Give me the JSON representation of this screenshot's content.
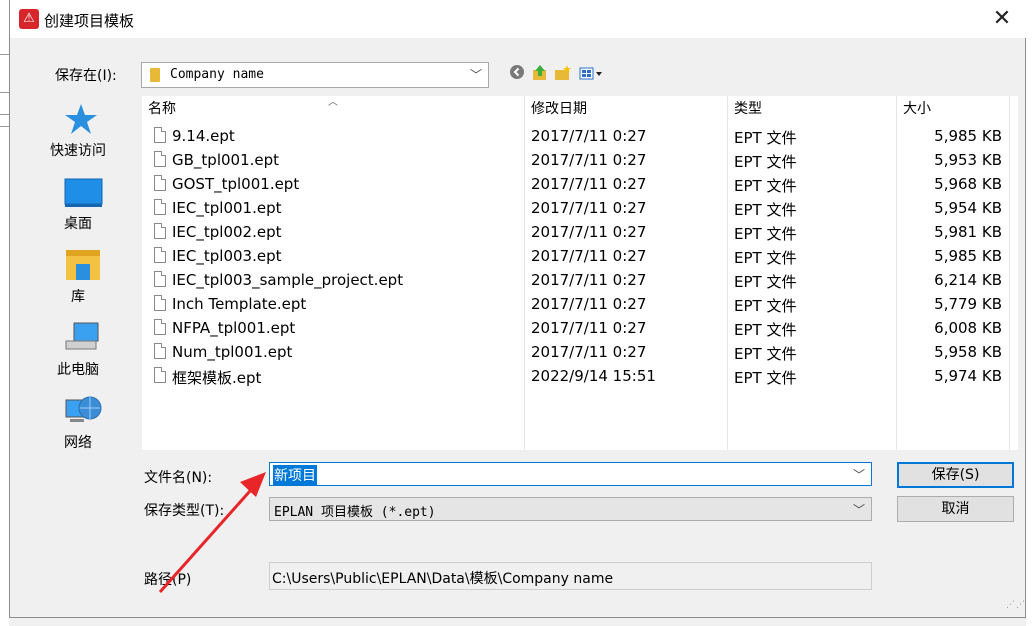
{
  "dialog": {
    "title": "创建项目模板",
    "close_glyph": "✕",
    "app_icon_glyph": "⚠"
  },
  "location": {
    "label": "保存在(I):",
    "value": "Company name"
  },
  "toolbar": {
    "back_icon": "back-icon",
    "up_icon": "up-folder-icon",
    "new_folder_icon": "new-folder-icon",
    "view_icon": "view-menu-icon"
  },
  "places": [
    {
      "label": "快速访问",
      "icon": "star-icon"
    },
    {
      "label": "桌面",
      "icon": "desktop-icon"
    },
    {
      "label": "库",
      "icon": "library-icon"
    },
    {
      "label": "此电脑",
      "icon": "computer-icon"
    },
    {
      "label": "网络",
      "icon": "network-icon"
    }
  ],
  "columns": {
    "name": "名称",
    "modified": "修改日期",
    "type": "类型",
    "size": "大小"
  },
  "files": [
    {
      "name": "9.14.ept",
      "modified": "2017/7/11 0:27",
      "type": "EPT 文件",
      "size": "5,985 KB"
    },
    {
      "name": "GB_tpl001.ept",
      "modified": "2017/7/11 0:27",
      "type": "EPT 文件",
      "size": "5,953 KB"
    },
    {
      "name": "GOST_tpl001.ept",
      "modified": "2017/7/11 0:27",
      "type": "EPT 文件",
      "size": "5,968 KB"
    },
    {
      "name": "IEC_tpl001.ept",
      "modified": "2017/7/11 0:27",
      "type": "EPT 文件",
      "size": "5,954 KB"
    },
    {
      "name": "IEC_tpl002.ept",
      "modified": "2017/7/11 0:27",
      "type": "EPT 文件",
      "size": "5,981 KB"
    },
    {
      "name": "IEC_tpl003.ept",
      "modified": "2017/7/11 0:27",
      "type": "EPT 文件",
      "size": "5,985 KB"
    },
    {
      "name": "IEC_tpl003_sample_project.ept",
      "modified": "2017/7/11 0:27",
      "type": "EPT 文件",
      "size": "6,214 KB"
    },
    {
      "name": "Inch Template.ept",
      "modified": "2017/7/11 0:27",
      "type": "EPT 文件",
      "size": "5,779 KB"
    },
    {
      "name": "NFPA_tpl001.ept",
      "modified": "2017/7/11 0:27",
      "type": "EPT 文件",
      "size": "6,008 KB"
    },
    {
      "name": "Num_tpl001.ept",
      "modified": "2017/7/11 0:27",
      "type": "EPT 文件",
      "size": "5,958 KB"
    },
    {
      "name": "框架模板.ept",
      "modified": "2022/9/14 15:51",
      "type": "EPT 文件",
      "size": "5,974 KB"
    }
  ],
  "filename": {
    "label": "文件名(N):",
    "value": "新项目"
  },
  "filetype": {
    "label": "保存类型(T):",
    "value": "EPLAN 项目模板 (*.ept)"
  },
  "path": {
    "label": "路径(P)",
    "value": "C:\\Users\\Public\\EPLAN\\Data\\模板\\Company name"
  },
  "buttons": {
    "save": "保存(S)",
    "cancel": "取消"
  },
  "colors": {
    "accent": "#0078d7",
    "annotation_arrow": "#e8262a"
  }
}
